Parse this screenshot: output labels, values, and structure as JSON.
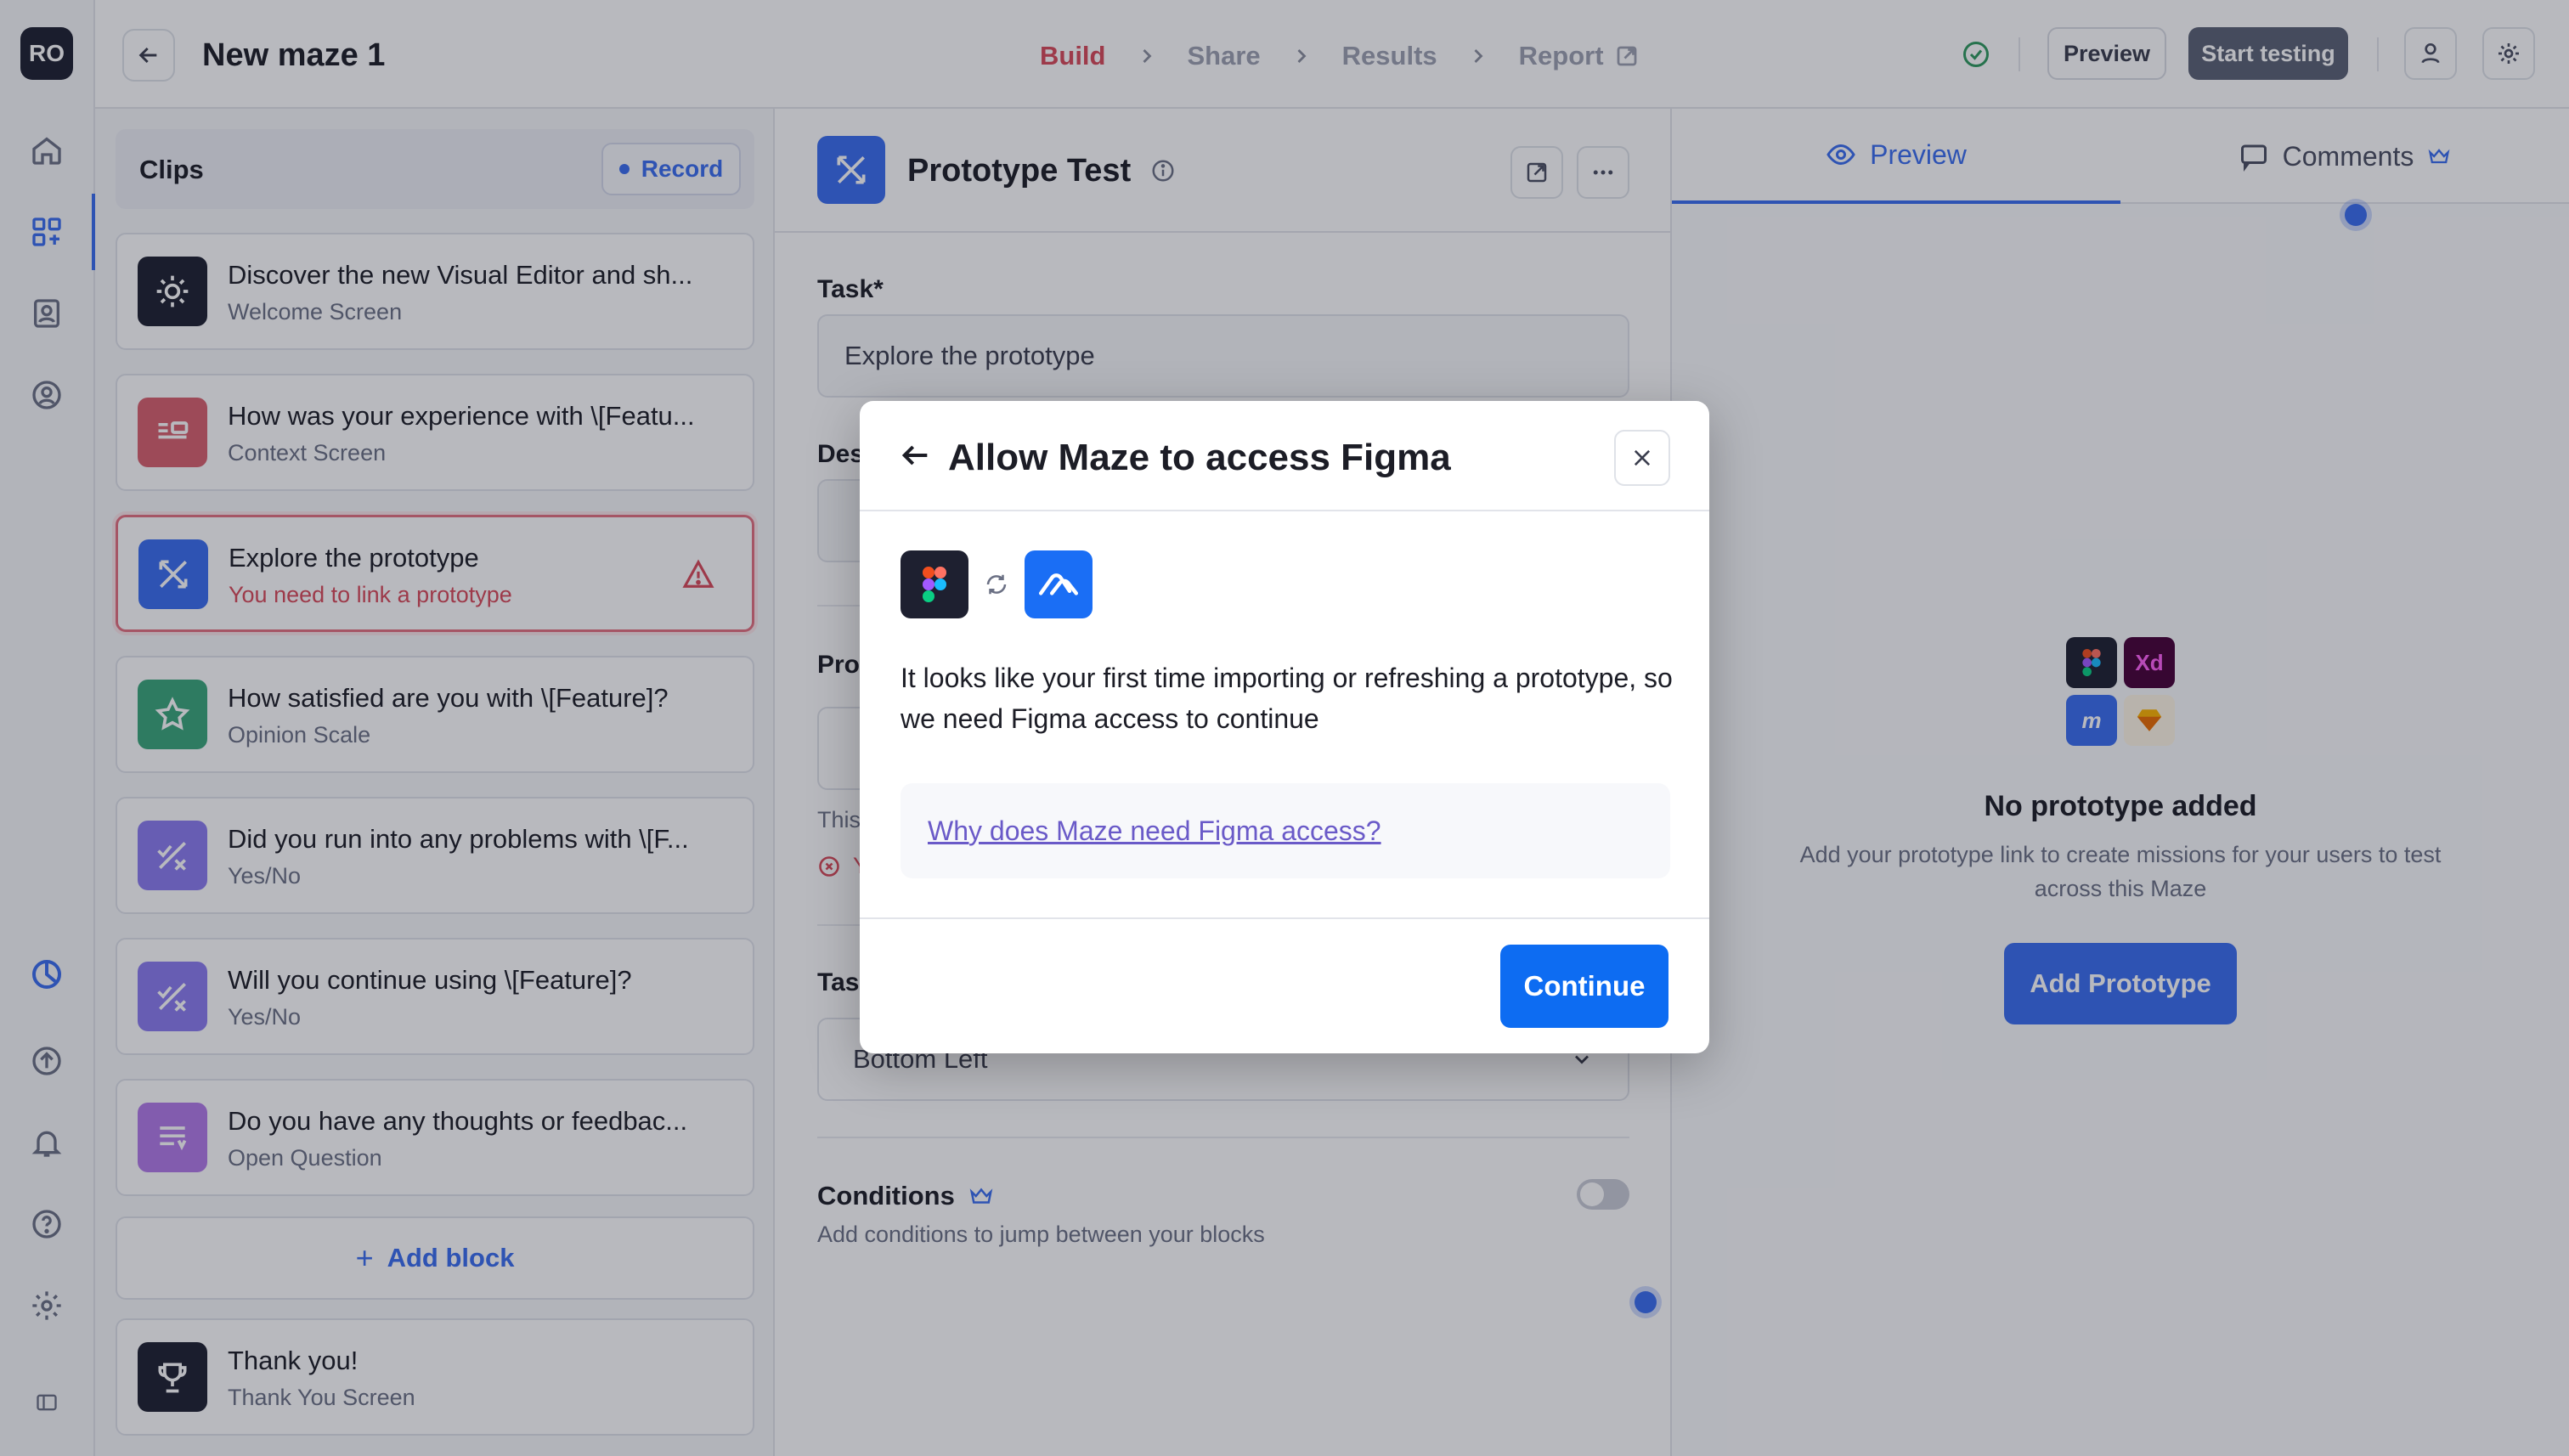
{
  "rail": {
    "avatar": "RO"
  },
  "topbar": {
    "title": "New maze 1",
    "steps": [
      "Build",
      "Share",
      "Results",
      "Report"
    ],
    "preview_label": "Preview",
    "start_label": "Start testing"
  },
  "clips": {
    "title": "Clips",
    "record_label": "Record",
    "blocks": [
      {
        "title": "Discover the new Visual Editor and sh...",
        "subtitle": "Welcome Screen",
        "color": "#1e2030",
        "icon": "sun-icon"
      },
      {
        "title": "How was your experience with \\[Featu...",
        "subtitle": "Context Screen",
        "color": "#d8606e",
        "icon": "context-icon"
      },
      {
        "title": "Explore the prototype",
        "subtitle": "You need to link a prototype",
        "color": "#3a6df0",
        "icon": "prototype-icon"
      },
      {
        "title": "How satisfied are you with \\[Feature]?",
        "subtitle": "Opinion Scale",
        "color": "#3aa77a",
        "icon": "star-icon"
      },
      {
        "title": "Did you run into any problems with \\[F...",
        "subtitle": "Yes/No",
        "color": "#8b7cf0",
        "icon": "yes-no-icon"
      },
      {
        "title": "Will you continue using \\[Feature]?",
        "subtitle": "Yes/No",
        "color": "#8b7cf0",
        "icon": "yes-no-icon"
      },
      {
        "title": "Do you have any thoughts or feedbac...",
        "subtitle": "Open Question",
        "color": "#b27ae8",
        "icon": "open-question-icon"
      }
    ],
    "add_block_label": "Add block",
    "thanks": {
      "title": "Thank you!",
      "subtitle": "Thank You Screen",
      "color": "#1e2030",
      "icon": "trophy-icon"
    }
  },
  "editor": {
    "title": "Prototype Test",
    "task_label": "Task*",
    "task_value": "Explore the prototype",
    "desc_fragment": "Des",
    "proto_fragment": "Pro",
    "this_fragment": "This",
    "err_fragment": "Y",
    "tasks_fragment": "Task",
    "position_value": "Bottom Left",
    "conditions_title": "Conditions",
    "conditions_sub": "Add conditions to jump between your blocks"
  },
  "right": {
    "tab_preview": "Preview",
    "tab_comments": "Comments",
    "tool_xd": "Xd",
    "tool_m": "m",
    "empty_title": "No prototype added",
    "empty_sub": "Add your prototype link to create missions for your users to test across this Maze",
    "add_label": "Add Prototype"
  },
  "modal": {
    "title": "Allow Maze to access Figma",
    "body": "It looks like your first time importing or refreshing a prototype, so we need Figma access to continue",
    "link": "Why does Maze need Figma access?",
    "continue_label": "Continue"
  }
}
